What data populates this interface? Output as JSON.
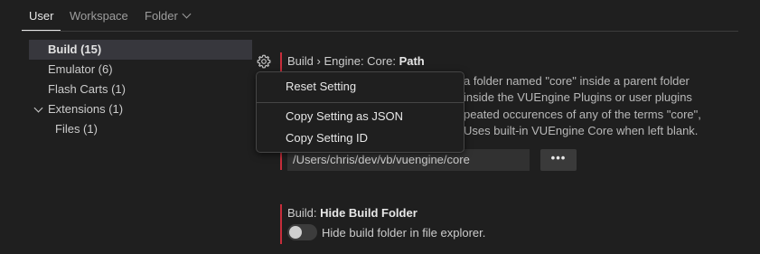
{
  "tabs": {
    "user": "User",
    "workspace": "Workspace",
    "folder": "Folder"
  },
  "toc": {
    "build": "Build (15)",
    "emulator": "Emulator (6)",
    "flash_carts": "Flash Carts (1)",
    "extensions": "Extensions (1)",
    "files": "Files (1)"
  },
  "setting_core_path": {
    "title_prefix": "Build › Engine: Core: ",
    "title_name": "Path",
    "description_lines": [
      "a folder named \"core\" inside a parent folder",
      "inside the VUEngine Plugins or user plugins",
      "peated occurences of any of the terms \"core\",",
      "Uses built-in VUEngine Core when left blank."
    ],
    "value": "/Users/chris/dev/vb/vuengine/core",
    "browse_label": "•••"
  },
  "context_menu": {
    "reset": "Reset Setting",
    "copy_json": "Copy Setting as JSON",
    "copy_id": "Copy Setting ID"
  },
  "setting_hide_build": {
    "title_prefix": "Build: ",
    "title_name": "Hide Build Folder",
    "checkbox_label": "Hide build folder in file explorer.",
    "enabled": false
  },
  "icons": {
    "settings": "gear-icon",
    "folder_dropdown": "chevron-down-icon",
    "extensions_toggle": "chevron-down-icon"
  },
  "colors": {
    "background": "#1f1f1f",
    "modified_indicator": "#c72e3b",
    "toc_selected": "#37373d"
  }
}
